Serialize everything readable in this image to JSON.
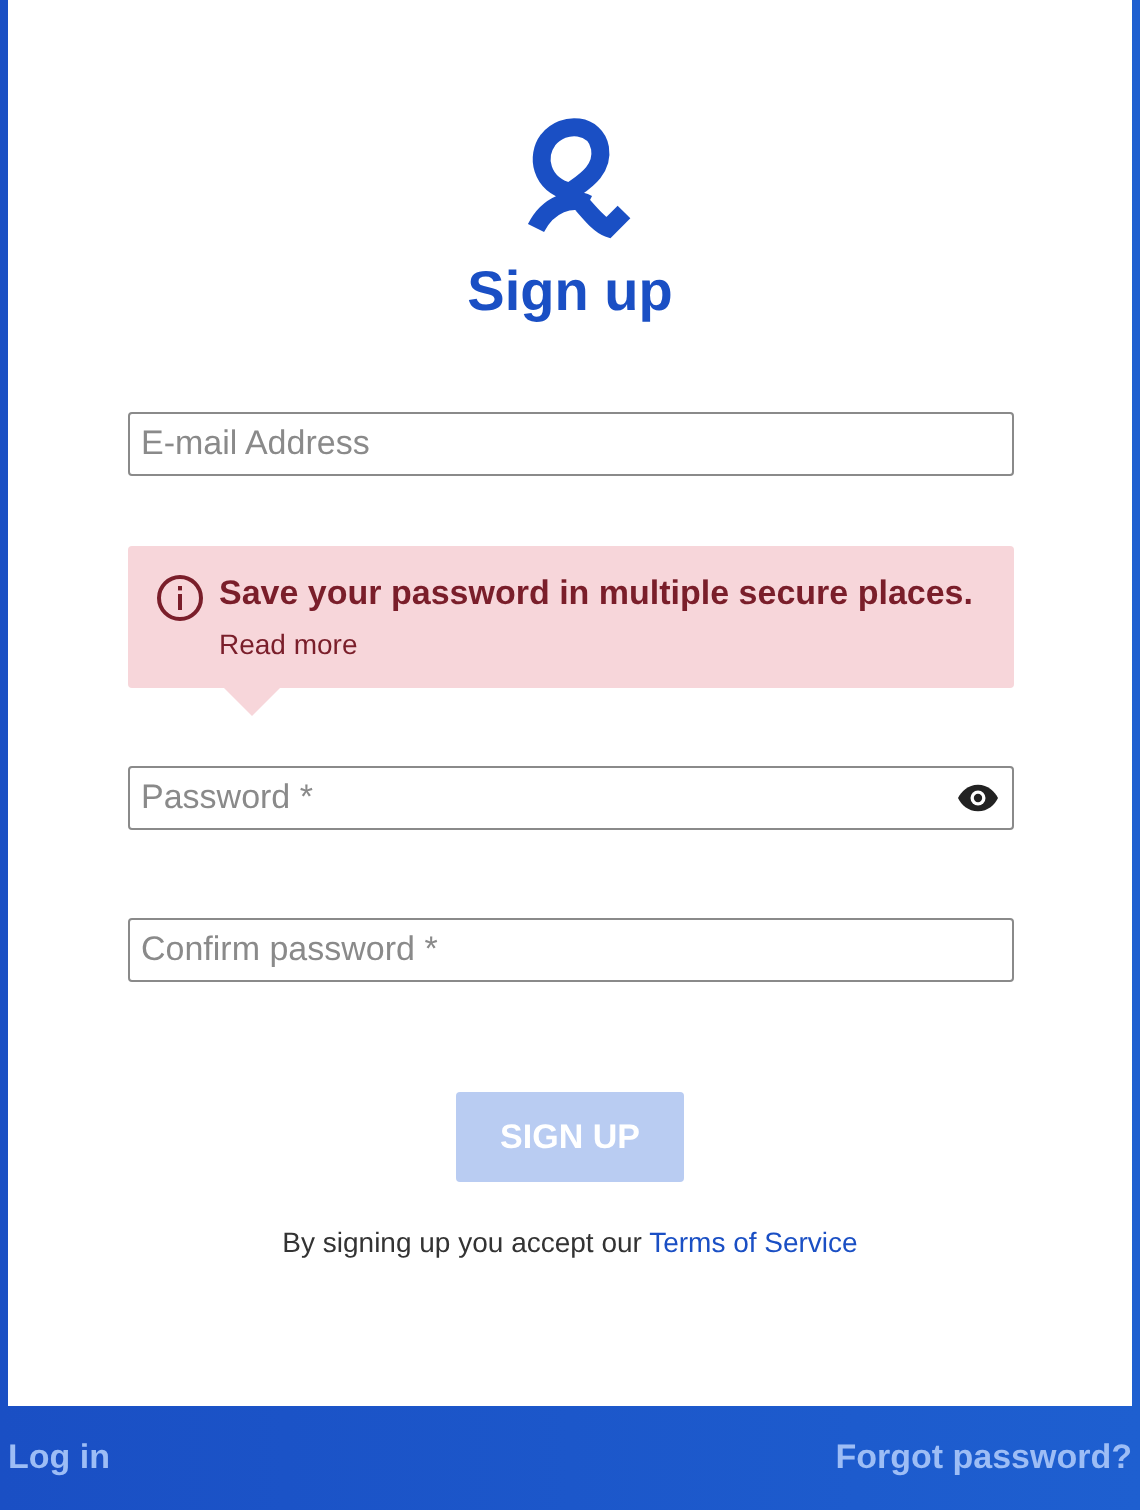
{
  "title": "Sign up",
  "fields": [
    {
      "placeholder": "E-mail Address",
      "kind": "text"
    },
    {
      "placeholder": "Password *",
      "kind": "password"
    },
    {
      "placeholder": "Confirm password *",
      "kind": "plain"
    }
  ],
  "notice": {
    "message": "Save your password in multiple secure places.",
    "link": "Read more"
  },
  "submit": {
    "label": "SIGN UP",
    "disabled": true
  },
  "terms": {
    "text": "By signing up you accept our",
    "link": "Terms of Service"
  },
  "footer": {
    "left": "Log in",
    "right": "Forgot password?"
  }
}
